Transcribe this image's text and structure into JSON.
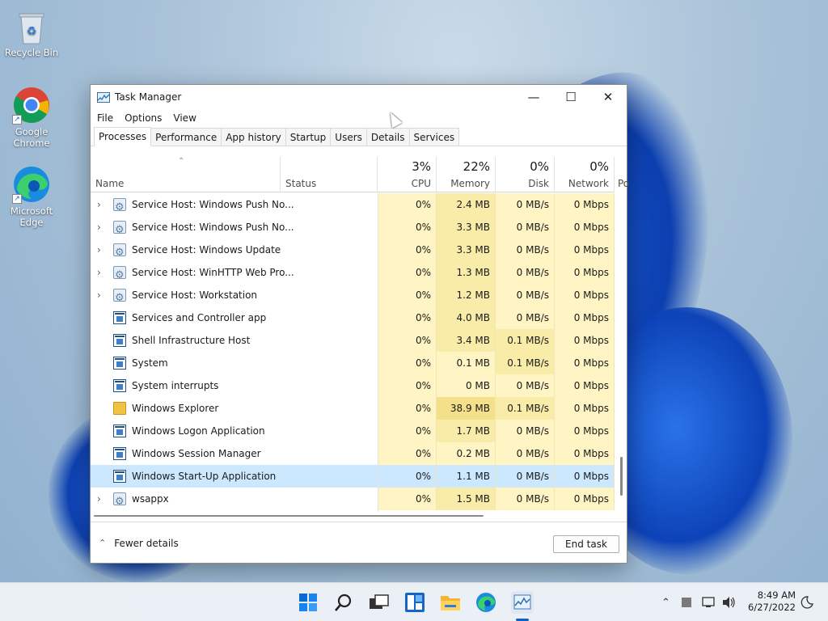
{
  "desktop": {
    "icons": [
      {
        "label": "Recycle Bin"
      },
      {
        "label": "Google Chrome"
      },
      {
        "label": "Microsoft Edge"
      }
    ]
  },
  "window": {
    "title": "Task Manager",
    "controls": {
      "minimize": "—",
      "maximize": "☐",
      "close": "✕"
    },
    "menu": [
      "File",
      "Options",
      "View"
    ],
    "tabs": [
      "Processes",
      "Performance",
      "App history",
      "Startup",
      "Users",
      "Details",
      "Services"
    ],
    "active_tab": "Processes"
  },
  "columns": {
    "name": {
      "label": "Name"
    },
    "status": {
      "label": "Status"
    },
    "cpu": {
      "usage": "3%",
      "label": "CPU"
    },
    "memory": {
      "usage": "22%",
      "label": "Memory"
    },
    "disk": {
      "usage": "0%",
      "label": "Disk"
    },
    "network": {
      "usage": "0%",
      "label": "Network"
    },
    "power_partial": "Po"
  },
  "processes": [
    {
      "expandable": true,
      "icon": "gear-icon",
      "name": "Service Host: Windows Push No...",
      "cpu": "0%",
      "memory": "2.4 MB",
      "disk": "0 MB/s",
      "network": "0 Mbps"
    },
    {
      "expandable": true,
      "icon": "gear-icon",
      "name": "Service Host: Windows Push No...",
      "cpu": "0%",
      "memory": "3.3 MB",
      "disk": "0 MB/s",
      "network": "0 Mbps"
    },
    {
      "expandable": true,
      "icon": "gear-icon",
      "name": "Service Host: Windows Update",
      "cpu": "0%",
      "memory": "3.3 MB",
      "disk": "0 MB/s",
      "network": "0 Mbps"
    },
    {
      "expandable": true,
      "icon": "gear-icon",
      "name": "Service Host: WinHTTP Web Pro...",
      "cpu": "0%",
      "memory": "1.3 MB",
      "disk": "0 MB/s",
      "network": "0 Mbps"
    },
    {
      "expandable": true,
      "icon": "gear-icon",
      "name": "Service Host: Workstation",
      "cpu": "0%",
      "memory": "1.2 MB",
      "disk": "0 MB/s",
      "network": "0 Mbps"
    },
    {
      "expandable": false,
      "icon": "window-icon",
      "name": "Services and Controller app",
      "cpu": "0%",
      "memory": "4.0 MB",
      "disk": "0 MB/s",
      "network": "0 Mbps"
    },
    {
      "expandable": false,
      "icon": "window-icon",
      "name": "Shell Infrastructure Host",
      "cpu": "0%",
      "memory": "3.4 MB",
      "disk": "0.1 MB/s",
      "network": "0 Mbps"
    },
    {
      "expandable": false,
      "icon": "window-icon",
      "name": "System",
      "cpu": "0%",
      "memory": "0.1 MB",
      "disk": "0.1 MB/s",
      "network": "0 Mbps"
    },
    {
      "expandable": false,
      "icon": "window-icon",
      "name": "System interrupts",
      "cpu": "0%",
      "memory": "0 MB",
      "disk": "0 MB/s",
      "network": "0 Mbps"
    },
    {
      "expandable": false,
      "icon": "folder-icon",
      "name": "Windows Explorer",
      "cpu": "0%",
      "memory": "38.9 MB",
      "disk": "0.1 MB/s",
      "network": "0 Mbps"
    },
    {
      "expandable": false,
      "icon": "window-icon",
      "name": "Windows Logon Application",
      "cpu": "0%",
      "memory": "1.7 MB",
      "disk": "0 MB/s",
      "network": "0 Mbps"
    },
    {
      "expandable": false,
      "icon": "window-icon",
      "name": "Windows Session Manager",
      "cpu": "0%",
      "memory": "0.2 MB",
      "disk": "0 MB/s",
      "network": "0 Mbps"
    },
    {
      "expandable": false,
      "icon": "window-icon",
      "name": "Windows Start-Up Application",
      "cpu": "0%",
      "memory": "1.1 MB",
      "disk": "0 MB/s",
      "network": "0 Mbps",
      "selected": true
    },
    {
      "expandable": true,
      "icon": "gear-icon",
      "name": "wsappx",
      "cpu": "0%",
      "memory": "1.5 MB",
      "disk": "0 MB/s",
      "network": "0 Mbps"
    }
  ],
  "footer": {
    "fewer_details": "Fewer details",
    "end_task": "End task"
  },
  "taskbar": {
    "icons": [
      "start-icon",
      "search-icon",
      "task-view-icon",
      "widgets-icon",
      "file-explorer-icon",
      "edge-icon",
      "task-manager-icon"
    ],
    "clock_time": "8:49 AM",
    "clock_date": "6/27/2022"
  },
  "colors": {
    "heat_light": "#fff4c4",
    "heat_med": "#f9eca8",
    "heat_strong": "#f4e08a",
    "selected": "#cce8ff",
    "accent": "#0b63c8"
  }
}
